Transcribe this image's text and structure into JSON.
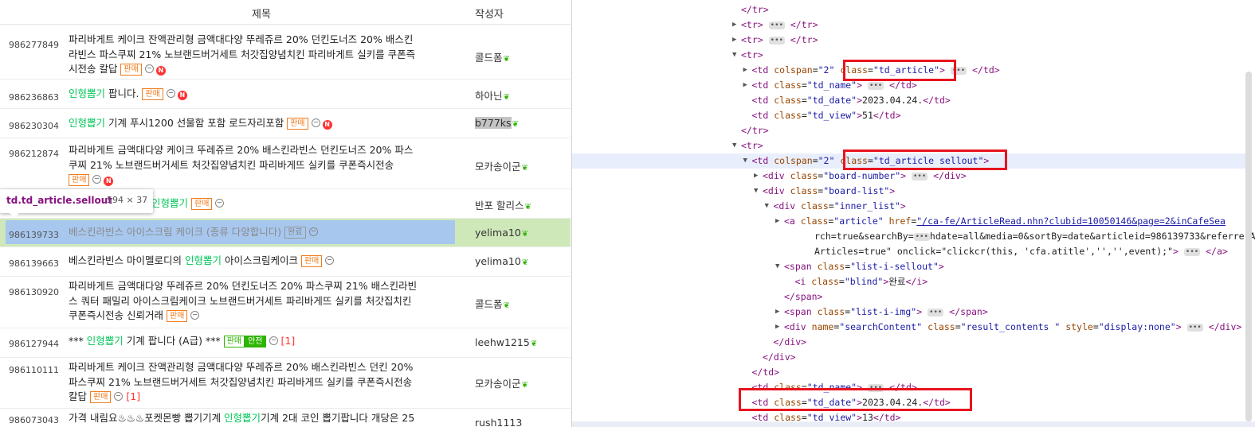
{
  "left": {
    "header": {
      "col_title": "제목",
      "col_author": "작성자"
    },
    "rows": [
      {
        "num": "986277849",
        "lines": [
          "파리바게트 케이크 잔액관리형 금액대다양 뚜레쥬르 20% 던킨도너즈 20% 배스킨",
          "라빈스 파스쿠찌 21% 노브랜드버거세트 처갓집양념치킨 파리바게트 실키를 쿠폰즉",
          "시전송 칼답"
        ],
        "tag": "판매",
        "author": "콜드폼"
      },
      {
        "num": "986236863",
        "green": "인형뽑기",
        "rest": " 팝니다.",
        "tag": "판매",
        "author": "하아닌"
      },
      {
        "num": "986230304",
        "green": "인형뽑기",
        "rest": " 기계 푸시1200 선물함 포함 로드자리포함",
        "tag": "판매",
        "author": "b777ks"
      },
      {
        "num": "986212874",
        "lines": [
          "파리바게트 금액대다양 케이크 뚜레쥬르 20% 배스킨라빈스 던킨도너즈 20% 파스",
          "쿠찌 21% 노브랜드버거세트 처갓집양념치킨 파리바게뜨 실키를 쿠폰즉시전송"
        ],
        "tag": "판매",
        "author": "모카송이군"
      },
      {
        "num": "",
        "green": "인형뽑기",
        "tag": "판매",
        "author": "반포 할리스"
      },
      {
        "num": "986139733",
        "rest": "베스킨라빈스 아이스크림 케이크 (종류 다양합니다)",
        "tag": "완료",
        "author": "yelima10"
      },
      {
        "num": "986139663",
        "rest": "베스킨라빈스 마이멜로디의 ",
        "green": "인형뽑기",
        "rest2": " 아이스크림케이크",
        "tag": "판매",
        "author": "yelima10"
      },
      {
        "num": "986130920",
        "lines": [
          "파리바게트 금액대다양 뚜레쥬르 20% 던킨도너즈 20% 파스쿠찌 21% 배스킨라빈",
          "스 쿼터 패밀리 아이스크림케이크 노브랜드버거세트 파리바게뜨 실키를 처갓집치킨",
          "쿠폰즉시전송 신뢰거래"
        ],
        "tag": "판매",
        "author": "콜드폼"
      },
      {
        "num": "986127944",
        "pre": "*** ",
        "green": "인형뽑기",
        "rest": " 기계 팝니다 (A급) ***",
        "tag": "판매",
        "tag2": "안전",
        "count": "[1]",
        "author": "leehw1215"
      },
      {
        "num": "986110111",
        "lines": [
          "파리바게트 케이크 잔액관리형 금액대다양 뚜레쥬르 20% 배스킨라빈스 던킨 20%",
          "파스쿠찌 21% 노브랜드버거세트 처갓집양념치킨 파리바게뜨 실키를 쿠폰즉시전송",
          "칼답"
        ],
        "tag": "판매",
        "count": "[1]",
        "author": "모카송이군"
      },
      {
        "num": "986073043",
        "rest": "가격 내림요♨♨♨포켓몬빵 뽑기기계 ",
        "green": "인형뽑기",
        "rest2": "기계 2대 코인 뽑기팝니다 개당은 25",
        "author": "rush1113"
      }
    ],
    "new_badge": "N",
    "tooltip": {
      "name": "td.td_article.sellout",
      "dims": "594 × 37"
    }
  },
  "devtools": {
    "lines": [
      {
        "ind": 0,
        "html": "</tr>"
      },
      {
        "ind": 0,
        "tw": "r",
        "html": "<tr> … </tr>"
      },
      {
        "ind": 0,
        "tw": "r",
        "html": "<tr> … </tr>"
      },
      {
        "ind": 0,
        "tw": "d",
        "html": "<tr>"
      },
      {
        "ind": 1,
        "tw": "r",
        "html": "<td colspan=\"2\" class=\"td_article\"> … </td>"
      },
      {
        "ind": 1,
        "tw": "r",
        "html": "<td class=\"td_name\"> … </td>"
      },
      {
        "ind": 1,
        "html": "<td class=\"td_date\">2023.04.24.</td>"
      },
      {
        "ind": 1,
        "html": "<td class=\"td_view\">51</td>"
      },
      {
        "ind": 0,
        "html": "</tr>"
      },
      {
        "ind": 0,
        "tw": "d",
        "html": "<tr>"
      },
      {
        "ind": 1,
        "tw": "d",
        "html": "<td colspan=\"2\" class=\"td_article sellout\">"
      },
      {
        "ind": 2,
        "tw": "r",
        "html": "<div class=\"board-number\"> … </div>"
      },
      {
        "ind": 2,
        "tw": "d",
        "html": "<div class=\"board-list\">"
      },
      {
        "ind": 3,
        "tw": "d",
        "html": "<div class=\"inner_list\">"
      },
      {
        "ind": 4,
        "tw": "r",
        "html": "<a class=\"article\" href=\"/ca-fe/ArticleRead.nhn?clubid=10050146&page=2&inCafeSea"
      },
      {
        "ind": 4,
        "html": "rch=true&searchBy=…hdate=all&media=0&sortBy=date&articleid=986139733&referrerAll"
      },
      {
        "ind": 4,
        "html": "Articles=true\" onclick=\"clickcr(this, 'cfa.atitle','','',event);\"> … </a>"
      },
      {
        "ind": 4,
        "tw": "d",
        "html": "<span class=\"list-i-sellout\">"
      },
      {
        "ind": 5,
        "html": "<i class=\"blind\">완료</i>"
      },
      {
        "ind": 4,
        "html": "</span>"
      },
      {
        "ind": 4,
        "tw": "r",
        "html": "<span class=\"list-i-img\"> … </span>"
      },
      {
        "ind": 4,
        "tw": "r",
        "html": "<div name=\"searchContent\" class=\"result_contents \" style=\"display:none\"> … </div>"
      },
      {
        "ind": 3,
        "html": "</div>"
      },
      {
        "ind": 2,
        "html": "</div>"
      },
      {
        "ind": 1,
        "html": "</td>"
      },
      {
        "ind": 1,
        "html": "<td class=\"td_name\"> … </td>"
      },
      {
        "ind": 1,
        "html": "<td class=\"td_date\">2023.04.24.</td>"
      },
      {
        "ind": 1,
        "html": "<td class=\"td_view\">13</td>"
      }
    ],
    "selected_line": 10,
    "colors": {
      "tag": "#881280",
      "attr": "#994500",
      "value": "#1a1aa6",
      "highlight_box": "#e8141e"
    }
  }
}
